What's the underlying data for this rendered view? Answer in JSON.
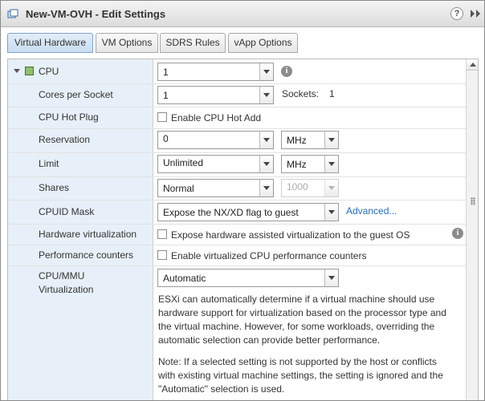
{
  "window": {
    "title": "New-VM-OVH - Edit Settings",
    "help_glyph": "?",
    "icons": [
      "vm-icon",
      "help-icon",
      "expand-icon"
    ]
  },
  "tabs": [
    {
      "label": "Virtual Hardware",
      "active": true
    },
    {
      "label": "VM Options",
      "active": false
    },
    {
      "label": "SDRS Rules",
      "active": false
    },
    {
      "label": "vApp Options",
      "active": false
    }
  ],
  "cpu": {
    "label": "CPU",
    "value": "1",
    "info_glyph": "i",
    "cores_per_socket": {
      "label": "Cores per Socket",
      "value": "1",
      "sockets_label": "Sockets:",
      "sockets_value": "1"
    },
    "hot_plug": {
      "label": "CPU Hot Plug",
      "checkbox_label": "Enable CPU Hot Add",
      "checked": false
    },
    "reservation": {
      "label": "Reservation",
      "value": "0",
      "unit": "MHz"
    },
    "limit": {
      "label": "Limit",
      "value": "Unlimited",
      "unit": "MHz"
    },
    "shares": {
      "label": "Shares",
      "value": "Normal",
      "amount": "1000"
    },
    "cpuid_mask": {
      "label": "CPUID Mask",
      "value": "Expose the NX/XD flag to guest",
      "advanced_link": "Advanced..."
    },
    "hw_virtualization": {
      "label": "Hardware virtualization",
      "checkbox_label": "Expose hardware assisted virtualization to the guest OS",
      "checked": false
    },
    "perf_counters": {
      "label": "Performance counters",
      "checkbox_label": "Enable virtualized CPU performance counters",
      "checked": false
    },
    "mmu": {
      "label_line1": "CPU/MMU",
      "label_line2": "Virtualization",
      "value": "Automatic",
      "desc1": "ESXi can automatically determine if a virtual machine should use hardware support for virtualization based on the processor type and the virtual machine. However, for some workloads, overriding the automatic selection can provide better performance.",
      "desc2": "Note: If a selected setting is not supported by the host or conflicts with existing virtual machine settings, the setting is ignored and the \"Automatic\" selection is used."
    }
  },
  "colors": {
    "label_column": "#e7f0f8",
    "active_tab": "#c9dcf1",
    "link": "#2a6cb0",
    "cpu_icon": "#8fc06f"
  }
}
